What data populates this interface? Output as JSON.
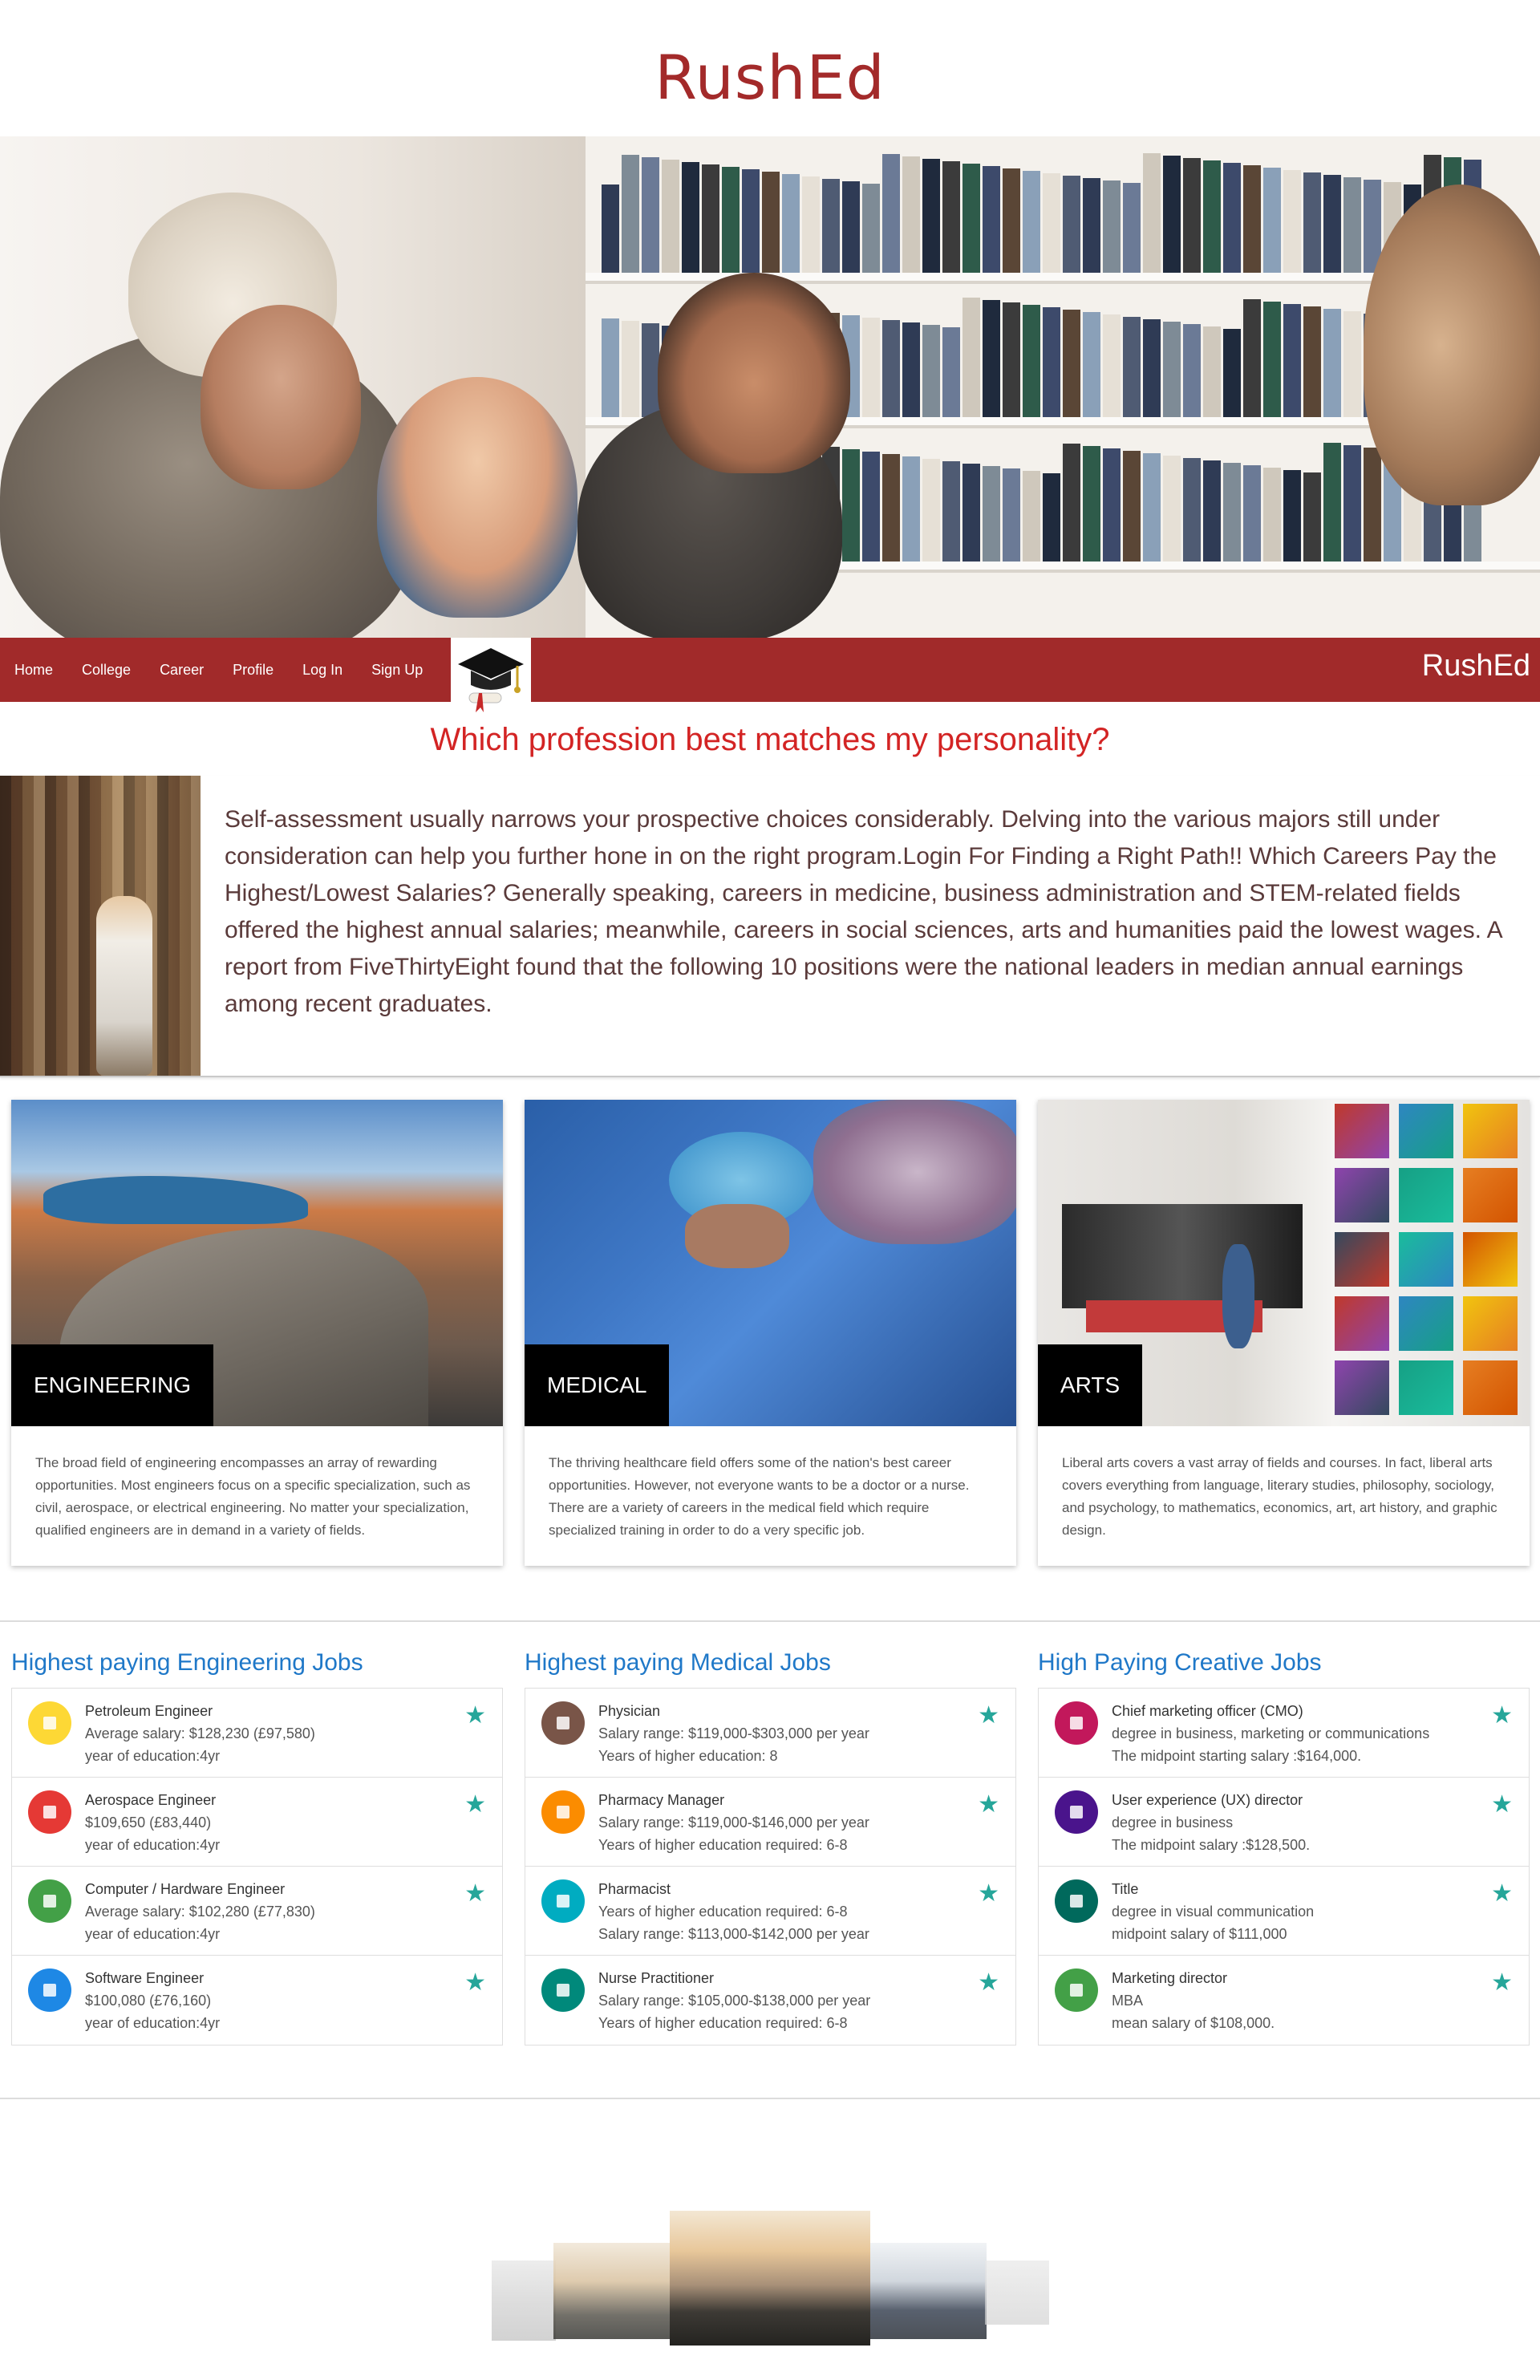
{
  "site": {
    "title": "RushEd",
    "brand": "RushEd"
  },
  "nav": {
    "items": [
      {
        "label": "Home"
      },
      {
        "label": "College"
      },
      {
        "label": "Career"
      },
      {
        "label": "Profile"
      },
      {
        "label": "Log In"
      },
      {
        "label": "Sign Up"
      }
    ],
    "logo_icon": "graduation-cap-icon"
  },
  "question": "Which profession best matches my personality?",
  "intro": {
    "text": "Self-assessment usually narrows your prospective choices considerably. Delving into the various majors still under consideration can help you further hone in on the right program.Login For Finding a Right Path!! Which Careers Pay the Highest/Lowest Salaries? Generally speaking, careers in medicine, business administration and STEM-related fields offered the highest annual salaries; meanwhile, careers in social sciences, arts and humanities paid the lowest wages. A report from FiveThirtyEight found that the following 10 positions were the national leaders in median annual earnings among recent graduates."
  },
  "cards": [
    {
      "label": "ENGINEERING",
      "body": "The broad field of engineering encompasses an array of rewarding opportunities. Most engineers focus on a specific specialization, such as civil, aerospace, or electrical engineering. No matter your specialization, qualified engineers are in demand in a variety of fields."
    },
    {
      "label": "MEDICAL",
      "body": "The thriving healthcare field offers some of the nation's best career opportunities. However, not everyone wants to be a doctor or a nurse. There are a variety of careers in the medical field which require specialized training in order to do a very specific job."
    },
    {
      "label": "ARTS",
      "body": "Liberal arts covers a vast array of fields and courses. In fact, liberal arts covers everything from language, literary studies, philosophy, sociology, and psychology, to mathematics, economics, art, art history, and graphic design."
    }
  ],
  "jobs": [
    {
      "heading": "Highest paying Engineering Jobs",
      "items": [
        {
          "title": "Petroleum Engineer",
          "line1": "Average salary: $128,230 (£97,580)",
          "line2": "year of education:4yr",
          "color": "#fdd835"
        },
        {
          "title": "Aerospace Engineer",
          "line1": "$109,650 (£83,440)",
          "line2": "year of education:4yr",
          "color": "#e53935"
        },
        {
          "title": "Computer / Hardware Engineer",
          "line1": "Average salary: $102,280 (£77,830)",
          "line2": "year of education:4yr",
          "color": "#43a047"
        },
        {
          "title": "Software Engineer",
          "line1": "$100,080 (£76,160)",
          "line2": "year of education:4yr",
          "color": "#1e88e5"
        }
      ]
    },
    {
      "heading": "Highest paying Medical Jobs",
      "items": [
        {
          "title": "Physician",
          "line1": "Salary range: $119,000-$303,000 per year",
          "line2": "Years of higher education: 8",
          "color": "#795548"
        },
        {
          "title": "Pharmacy Manager",
          "line1": "Salary range: $119,000-$146,000 per year",
          "line2": "Years of higher education required: 6-8",
          "color": "#fb8c00"
        },
        {
          "title": "Pharmacist",
          "line1": "Years of higher education required: 6-8",
          "line2": "Salary range: $113,000-$142,000 per year",
          "color": "#00acc1"
        },
        {
          "title": "Nurse Practitioner",
          "line1": "Salary range: $105,000-$138,000 per year",
          "line2": "Years of higher education required: 6-8",
          "color": "#00897b"
        }
      ]
    },
    {
      "heading": "High Paying Creative Jobs",
      "items": [
        {
          "title": "Chief marketing officer (CMO)",
          "line1": "degree in business, marketing or communications",
          "line2": "The midpoint starting salary :$164,000.",
          "color": "#c2185b"
        },
        {
          "title": "User experience (UX) director",
          "line1": "degree in business",
          "line2": "The midpoint salary :$128,500.",
          "color": "#4a148c"
        },
        {
          "title": "Title",
          "line1": "degree in visual communication",
          "line2": "midpoint salary of $111,000",
          "color": "#00695c"
        },
        {
          "title": "Marketing director",
          "line1": "MBA",
          "line2": "mean salary of $108,000.",
          "color": "#43a047"
        }
      ]
    }
  ]
}
